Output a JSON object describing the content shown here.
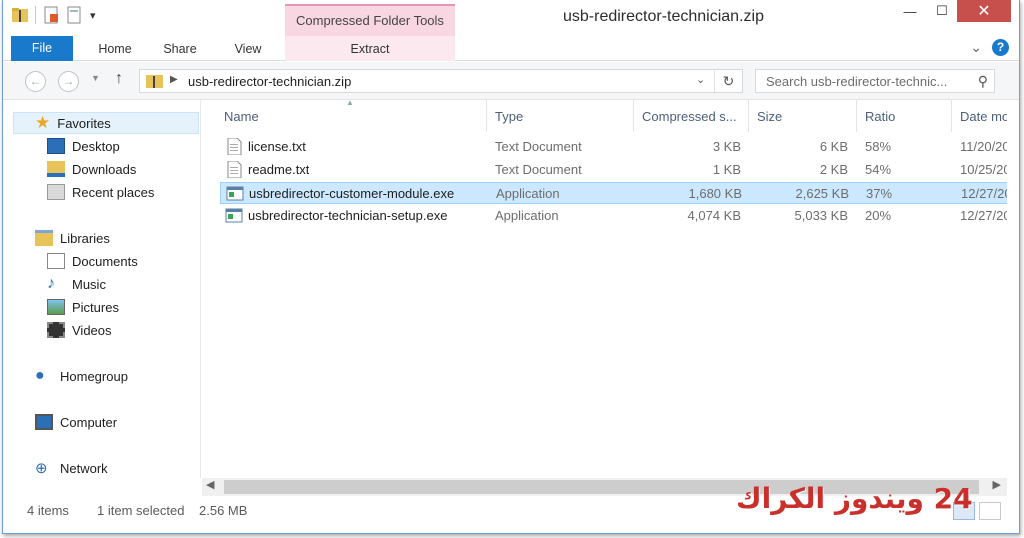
{
  "titlebar": {
    "context_tab": "Compressed Folder Tools",
    "title": "usb-redirector-technician.zip",
    "minimize": "—",
    "maximize": "☐",
    "close": "✕"
  },
  "ribbon": {
    "tabs": {
      "file": "File",
      "home": "Home",
      "share": "Share",
      "view": "View",
      "extract": "Extract"
    },
    "expand": "⌄",
    "help": "?"
  },
  "navbar": {
    "back": "←",
    "forward": "→",
    "up": "↑",
    "address": "usb-redirector-technician.zip",
    "search_placeholder": "Search usb-redirector-technic..."
  },
  "navpane": {
    "favorites": {
      "label": "Favorites",
      "items": [
        "Desktop",
        "Downloads",
        "Recent places"
      ]
    },
    "libraries": {
      "label": "Libraries",
      "items": [
        "Documents",
        "Music",
        "Pictures",
        "Videos"
      ]
    },
    "homegroup": "Homegroup",
    "computer": "Computer",
    "network": "Network"
  },
  "columns": [
    "Name",
    "Type",
    "Compressed s...",
    "Size",
    "Ratio",
    "Date mo"
  ],
  "files": [
    {
      "name": "license.txt",
      "type": "Text Document",
      "compressed": "3 KB",
      "size": "6 KB",
      "ratio": "58%",
      "date": "11/20/20",
      "icon": "text-file-icon"
    },
    {
      "name": "readme.txt",
      "type": "Text Document",
      "compressed": "1 KB",
      "size": "2 KB",
      "ratio": "54%",
      "date": "10/25/20",
      "icon": "text-file-icon"
    },
    {
      "name": "usbredirector-customer-module.exe",
      "type": "Application",
      "compressed": "1,680 KB",
      "size": "2,625 KB",
      "ratio": "37%",
      "date": "12/27/20",
      "icon": "application-icon",
      "selected": true
    },
    {
      "name": "usbredirector-technician-setup.exe",
      "type": "Application",
      "compressed": "4,074 KB",
      "size": "5,033 KB",
      "ratio": "20%",
      "date": "12/27/20",
      "icon": "application-icon"
    }
  ],
  "status": {
    "items": "4 items",
    "selected": "1 item selected",
    "size": "2.56 MB"
  },
  "watermark": "24 ويندوز الكراك",
  "colors": {
    "accent": "#1979ca",
    "context_tab": "#f8d7e3",
    "selection": "#cce8ff",
    "close": "#c7504c"
  }
}
